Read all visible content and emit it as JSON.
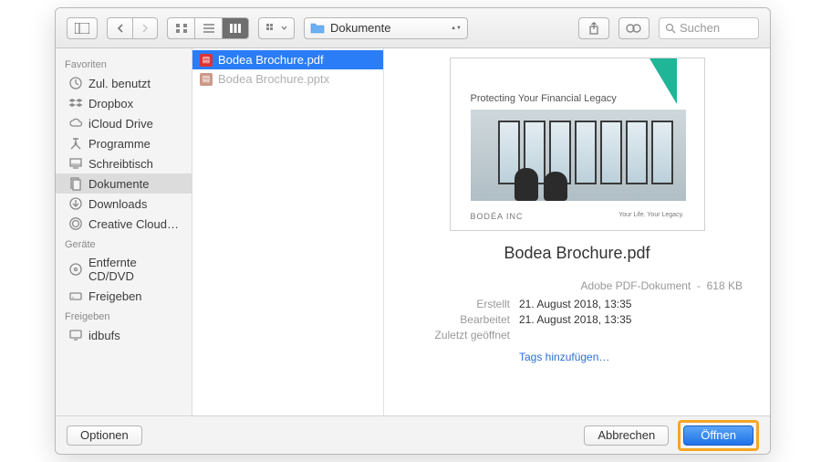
{
  "toolbar": {
    "path_label": "Dokumente",
    "search_placeholder": "Suchen"
  },
  "sidebar": {
    "sections": [
      {
        "header": "Favoriten",
        "items": [
          {
            "label": "Zul. benutzt",
            "icon": "clock"
          },
          {
            "label": "Dropbox",
            "icon": "dropbox"
          },
          {
            "label": "iCloud Drive",
            "icon": "cloud"
          },
          {
            "label": "Programme",
            "icon": "apps"
          },
          {
            "label": "Schreibtisch",
            "icon": "desktop"
          },
          {
            "label": "Dokumente",
            "icon": "documents",
            "selected": true
          },
          {
            "label": "Downloads",
            "icon": "downloads"
          },
          {
            "label": "Creative Cloud…",
            "icon": "cc"
          }
        ]
      },
      {
        "header": "Geräte",
        "items": [
          {
            "label": "Entfernte CD/DVD",
            "icon": "disc"
          },
          {
            "label": "Freigeben",
            "icon": "drive"
          }
        ]
      },
      {
        "header": "Freigeben",
        "items": [
          {
            "label": "idbufs",
            "icon": "display"
          }
        ]
      }
    ]
  },
  "files": [
    {
      "name": "Bodea Brochure.pdf",
      "type": "pdf",
      "selected": true
    },
    {
      "name": "Bodea Brochure.pptx",
      "type": "pptx",
      "dim": true
    }
  ],
  "preview": {
    "title": "Bodea Brochure.pdf",
    "thumb_caption": "Protecting Your Financial Legacy",
    "thumb_brand": "BODÉA INC",
    "thumb_tag": "Your Life. Your Legacy.",
    "kind": "Adobe PDF-Dokument",
    "size": "618 KB",
    "rows": [
      {
        "label": "Erstellt",
        "value": "21. August 2018, 13:35"
      },
      {
        "label": "Bearbeitet",
        "value": "21. August 2018, 13:35"
      },
      {
        "label": "Zuletzt geöffnet",
        "value": ""
      }
    ],
    "tags_link": "Tags hinzufügen…"
  },
  "footer": {
    "options": "Optionen",
    "cancel": "Abbrechen",
    "open": "Öffnen"
  }
}
